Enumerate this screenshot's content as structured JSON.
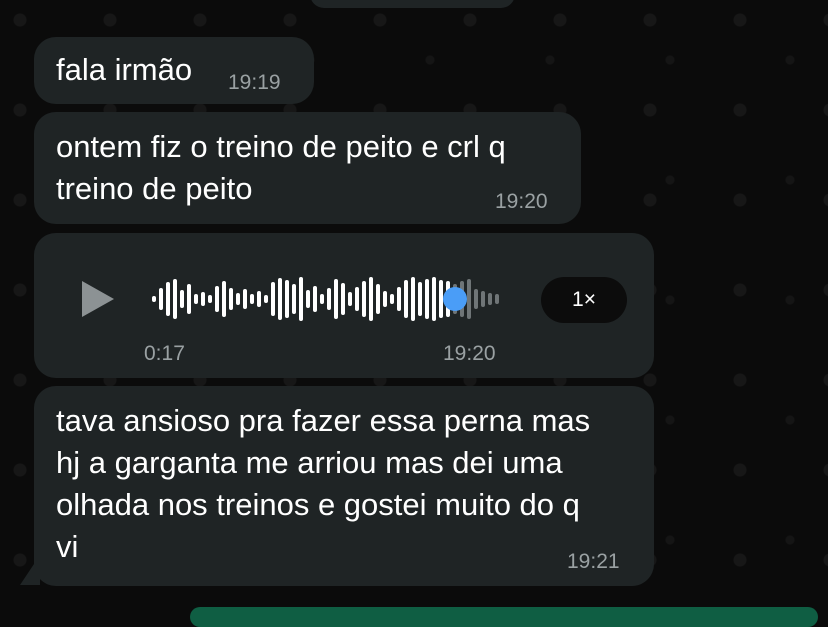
{
  "messages": [
    {
      "text": "fala irmão",
      "time": "19:19"
    },
    {
      "text": "ontem fiz o treino de peito e crl q\ntreino de peito",
      "time": "19:20"
    },
    {
      "voice": {
        "duration": "0:17",
        "time": "19:20",
        "speed": "1×",
        "progress": 0.86,
        "play_icon": "play-icon"
      }
    },
    {
      "text": "tava ansioso pra fazer essa perna mas\nhj a garganta me arriou mas dei uma\nolhada nos treinos e gostei muito do q\nvi",
      "time": "19:21"
    }
  ],
  "colors": {
    "bubble": "#1f2425",
    "timestamp": "#9aa1a3",
    "progress": "#4a9df7"
  }
}
